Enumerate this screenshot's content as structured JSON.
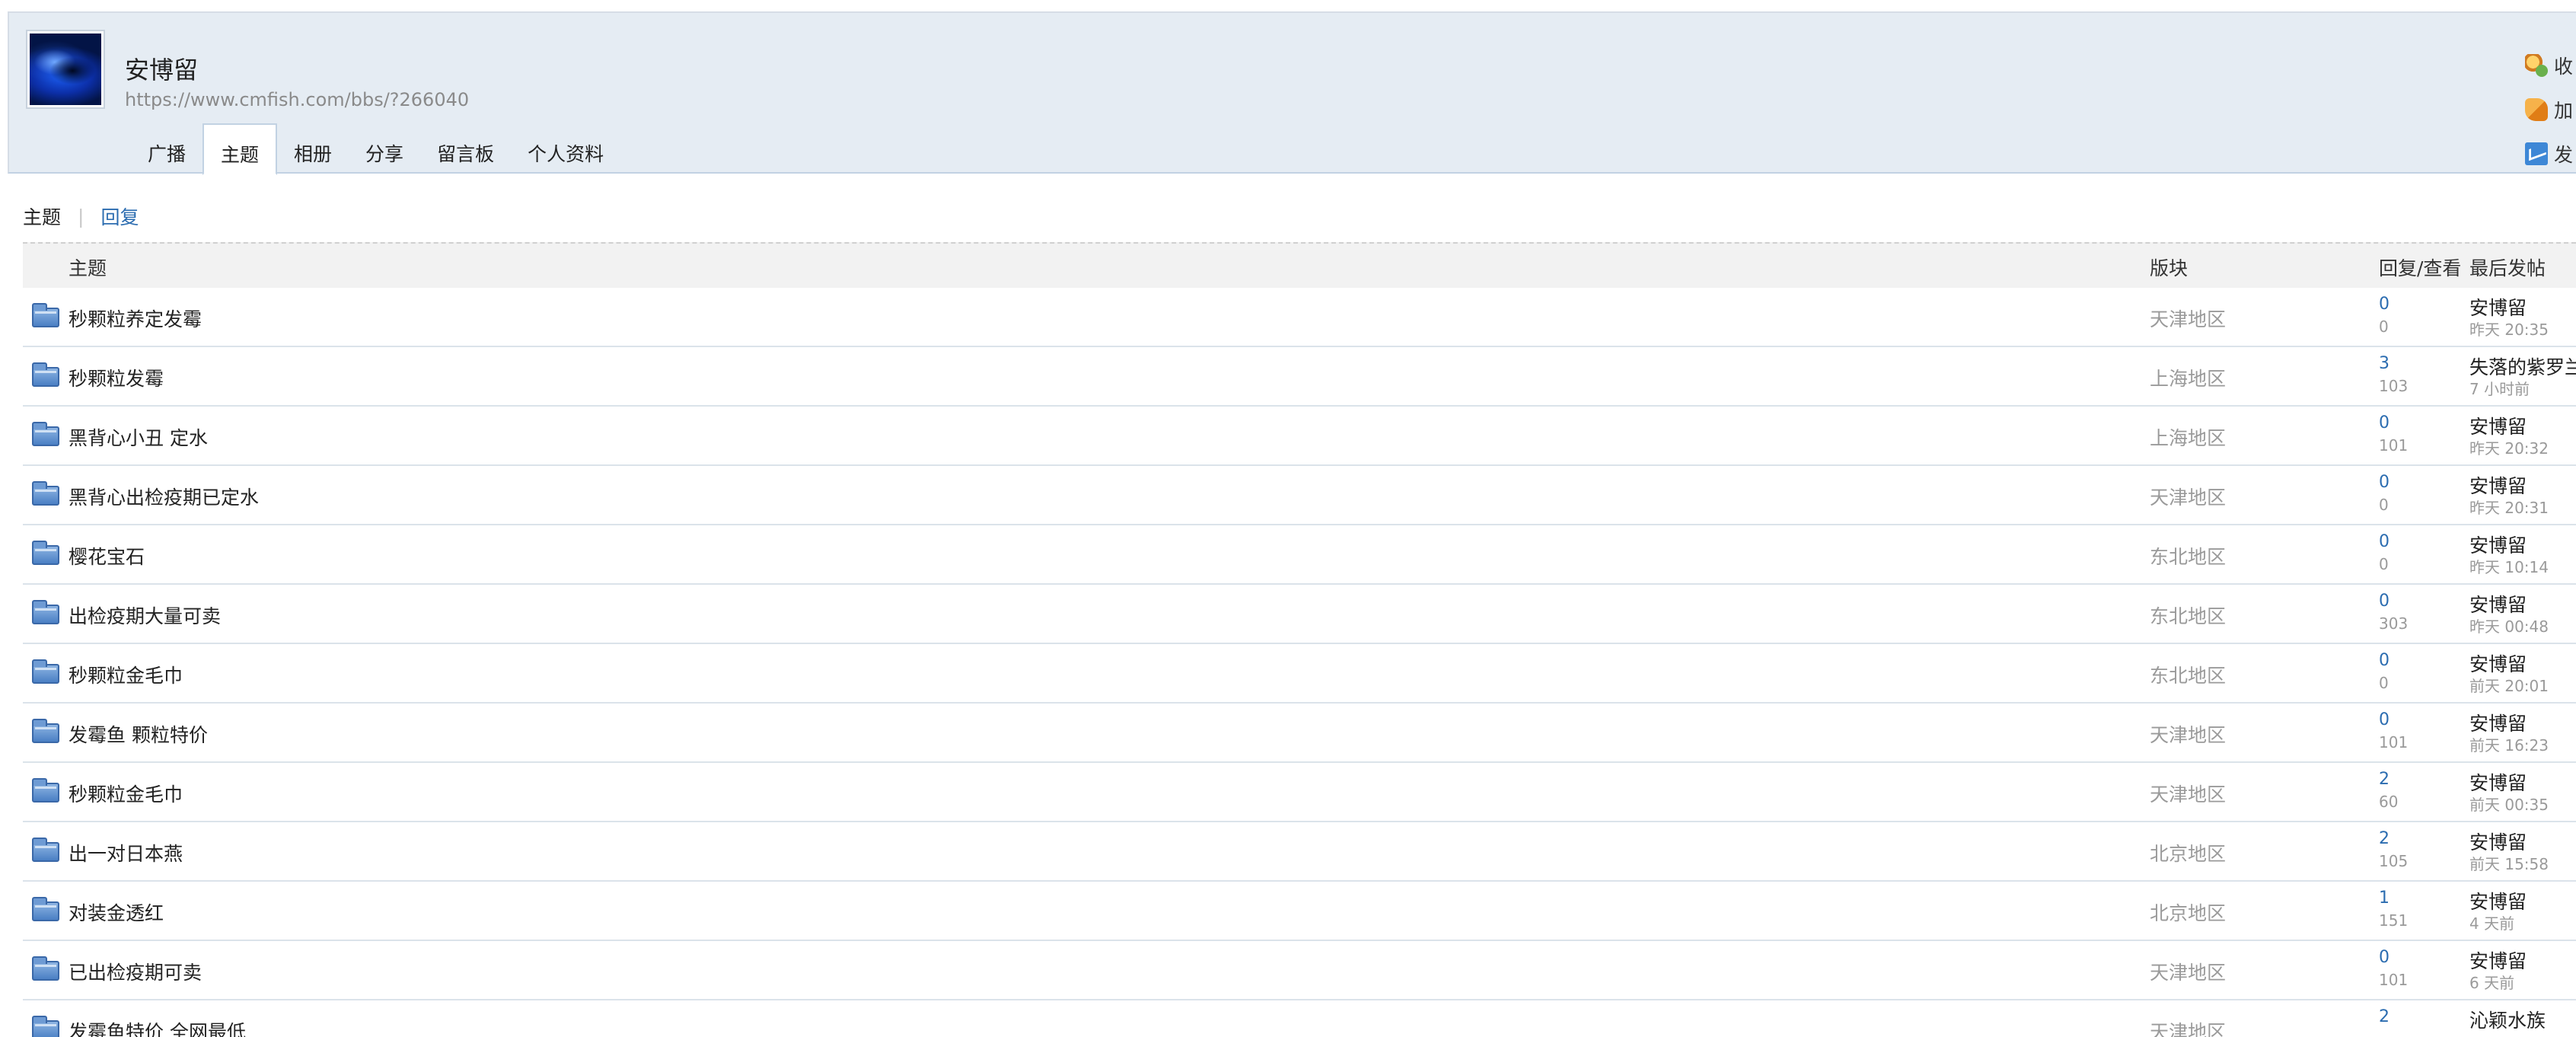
{
  "profile": {
    "username": "安博留",
    "url": "https://www.cmfish.com/bbs/?266040"
  },
  "tabs": [
    {
      "label": "广播",
      "active": false
    },
    {
      "label": "主题",
      "active": true
    },
    {
      "label": "相册",
      "active": false
    },
    {
      "label": "分享",
      "active": false
    },
    {
      "label": "留言板",
      "active": false
    },
    {
      "label": "个人资料",
      "active": false
    }
  ],
  "actions": [
    {
      "label": "收",
      "icon": "favorite-icon"
    },
    {
      "label": "加",
      "icon": "add-friend-icon"
    },
    {
      "label": "发",
      "icon": "message-icon"
    }
  ],
  "filter": {
    "current": "主题",
    "separator": "|",
    "other": "回复"
  },
  "table": {
    "headers": {
      "topic": "主题",
      "forum": "版块",
      "stats": "回复/查看",
      "last": "最后发帖"
    },
    "rows": [
      {
        "title": "秒颗粒养定发霉",
        "forum": "天津地区",
        "replies": "0",
        "views": "0",
        "last_user": "安博留",
        "last_time": "昨天 20:35"
      },
      {
        "title": "秒颗粒发霉",
        "forum": "上海地区",
        "replies": "3",
        "views": "103",
        "last_user": "失落的紫罗兰",
        "last_time": "7 小时前"
      },
      {
        "title": "黑背心小丑 定水",
        "forum": "上海地区",
        "replies": "0",
        "views": "101",
        "last_user": "安博留",
        "last_time": "昨天 20:32"
      },
      {
        "title": "黑背心出检疫期已定水",
        "forum": "天津地区",
        "replies": "0",
        "views": "0",
        "last_user": "安博留",
        "last_time": "昨天 20:31"
      },
      {
        "title": "樱花宝石",
        "forum": "东北地区",
        "replies": "0",
        "views": "0",
        "last_user": "安博留",
        "last_time": "昨天 10:14"
      },
      {
        "title": "出检疫期大量可卖",
        "forum": "东北地区",
        "replies": "0",
        "views": "303",
        "last_user": "安博留",
        "last_time": "昨天 00:48"
      },
      {
        "title": "秒颗粒金毛巾",
        "forum": "东北地区",
        "replies": "0",
        "views": "0",
        "last_user": "安博留",
        "last_time": "前天 20:01"
      },
      {
        "title": "发霉鱼 颗粒特价",
        "forum": "天津地区",
        "replies": "0",
        "views": "101",
        "last_user": "安博留",
        "last_time": "前天 16:23"
      },
      {
        "title": "秒颗粒金毛巾",
        "forum": "天津地区",
        "replies": "2",
        "views": "60",
        "last_user": "安博留",
        "last_time": "前天 00:35"
      },
      {
        "title": "出一对日本燕",
        "forum": "北京地区",
        "replies": "2",
        "views": "105",
        "last_user": "安博留",
        "last_time": "前天 15:58"
      },
      {
        "title": "对装金透红",
        "forum": "北京地区",
        "replies": "1",
        "views": "151",
        "last_user": "安博留",
        "last_time": "4 天前"
      },
      {
        "title": "已出检疫期可卖",
        "forum": "天津地区",
        "replies": "0",
        "views": "101",
        "last_user": "安博留",
        "last_time": "6 天前"
      },
      {
        "title": "发霉鱼特价 全网最低",
        "forum": "天津地区",
        "replies": "2",
        "views": "",
        "last_user": "沁颖水族",
        "last_time": ""
      }
    ]
  }
}
